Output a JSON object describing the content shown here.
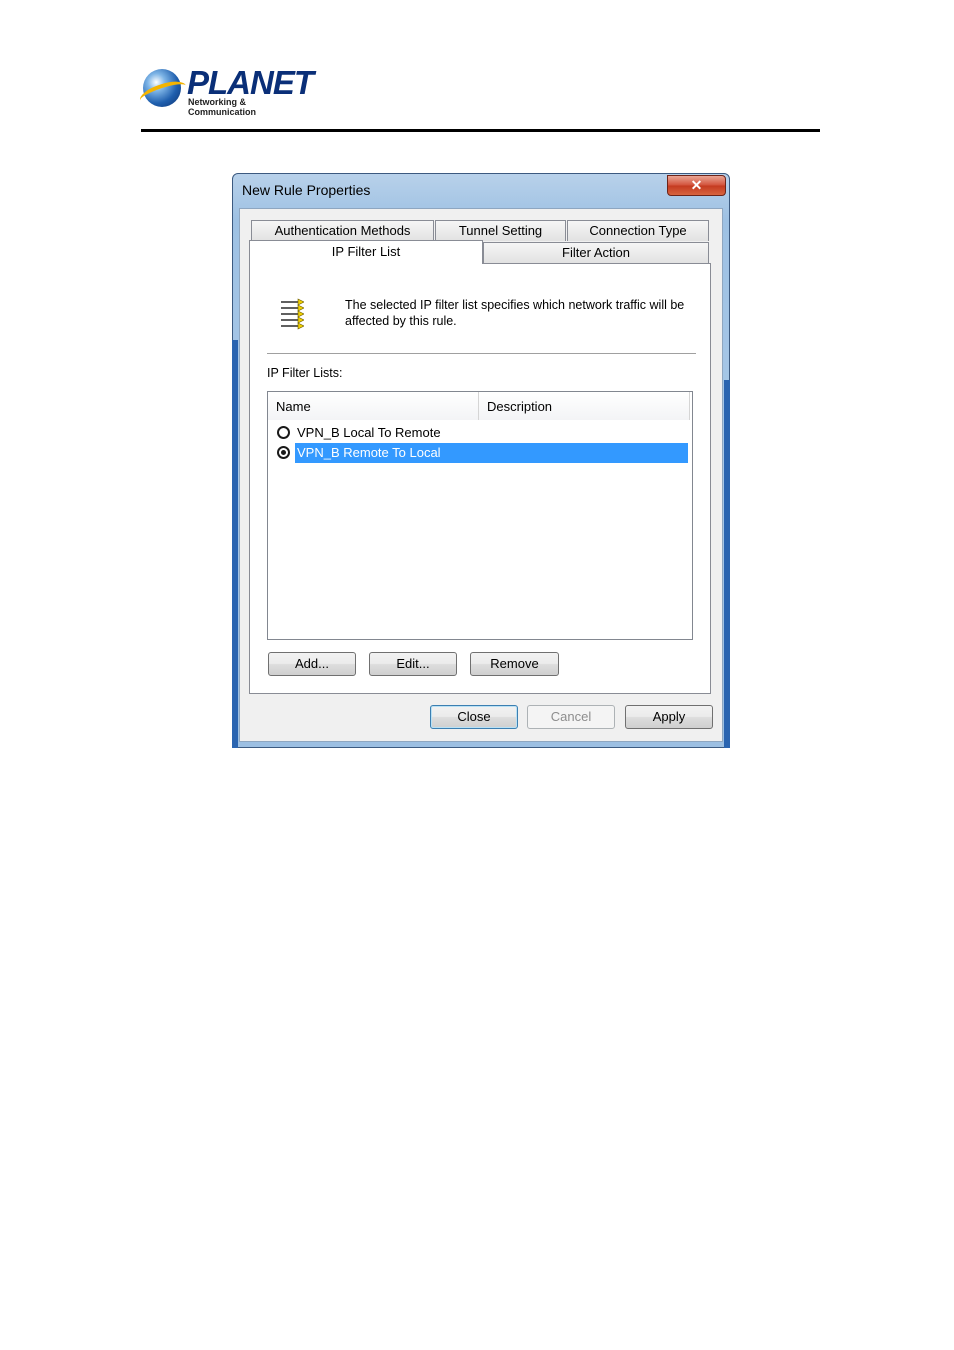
{
  "header": {
    "logo_word": "PLANET",
    "logo_tagline": "Networking & Communication"
  },
  "dialog": {
    "title": "New Rule Properties",
    "close_glyph": "✕",
    "tabs_top": [
      "Authentication Methods",
      "Tunnel Setting",
      "Connection Type"
    ],
    "tabs_bottom": [
      "IP Filter List",
      "Filter Action"
    ],
    "active_tab": "IP Filter List",
    "description": "The selected IP filter list specifies which network traffic will be affected by this rule.",
    "lists_label": "IP Filter Lists:",
    "columns": [
      "Name",
      "Description"
    ],
    "rows": [
      {
        "name": "VPN_B Local To Remote",
        "checked": false
      },
      {
        "name": "VPN_B Remote To Local",
        "checked": true
      }
    ],
    "buttons": {
      "add": "Add...",
      "edit": "Edit...",
      "remove": "Remove"
    },
    "footer": {
      "close": "Close",
      "cancel": "Cancel",
      "apply": "Apply"
    }
  },
  "colors": {
    "selection": "#3399ff",
    "title_close": "#c43a20",
    "brand": "#0a2f78"
  }
}
